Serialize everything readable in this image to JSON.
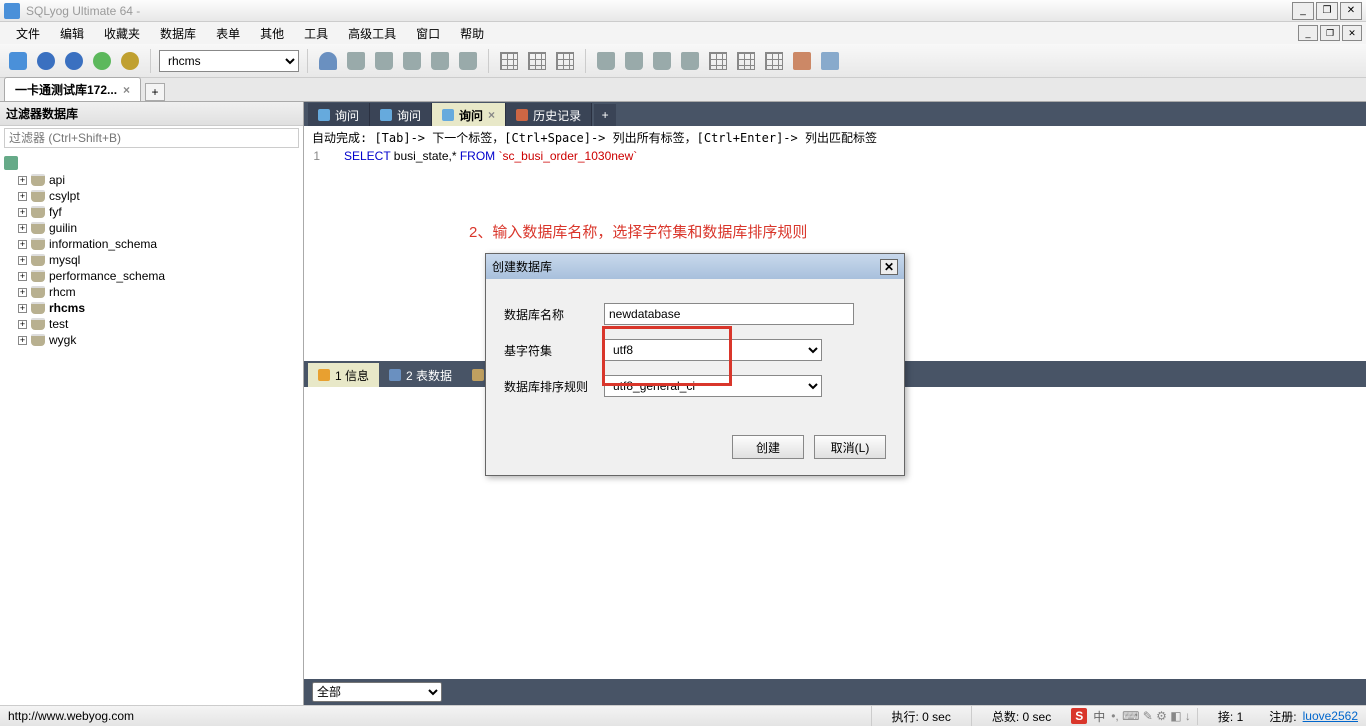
{
  "titlebar": {
    "title": "SQLyog Ultimate 64 -"
  },
  "menu": {
    "items": [
      "文件",
      "编辑",
      "收藏夹",
      "数据库",
      "表单",
      "其他",
      "工具",
      "高级工具",
      "窗口",
      "帮助"
    ]
  },
  "toolbar": {
    "db_selected": "rhcms"
  },
  "conn_tabs": {
    "tab1": "一卡通测试库172..."
  },
  "sidebar": {
    "header": "过滤器数据库",
    "filter_placeholder": "过滤器 (Ctrl+Shift+B)",
    "root": "",
    "databases": [
      "api",
      "csylpt",
      "fyf",
      "guilin",
      "information_schema",
      "mysql",
      "performance_schema",
      "rhcm",
      "rhcms",
      "test",
      "wygk"
    ]
  },
  "query_tabs": {
    "t1": "询问",
    "t2": "询问",
    "t3": "询问",
    "t4": "历史记录"
  },
  "editor": {
    "hint": "自动完成: [Tab]-> 下一个标签，[Ctrl+Space]-> 列出所有标签，[Ctrl+Enter]-> 列出匹配标签",
    "line_no": "1",
    "kw_select": "SELECT",
    "code_mid": " busi_state,* ",
    "kw_from": "FROM",
    "code_table": " `sc_busi_order_1030new`"
  },
  "annotation": "2、输入数据库名称，选择字符集和数据库排序规则",
  "result_tabs": {
    "info": "1 信息",
    "data": "2 表数据",
    "prof": ""
  },
  "result_footer": {
    "all": "全部"
  },
  "dialog": {
    "title": "创建数据库",
    "name_label": "数据库名称",
    "name_value": "newdatabase",
    "charset_label": "基字符集",
    "charset_value": "utf8",
    "collation_label": "数据库排序规则",
    "collation_value": "utf8_general_ci",
    "create_btn": "创建",
    "cancel_btn": "取消(L)"
  },
  "statusbar": {
    "url": "http://www.webyog.com",
    "exec": "执行: 0 sec",
    "total": "总数: 0 sec",
    "conn": "接: 1",
    "reg_label": "注册: ",
    "reg_user": "luove2562",
    "ime": "S",
    "ime_lang": "中"
  }
}
